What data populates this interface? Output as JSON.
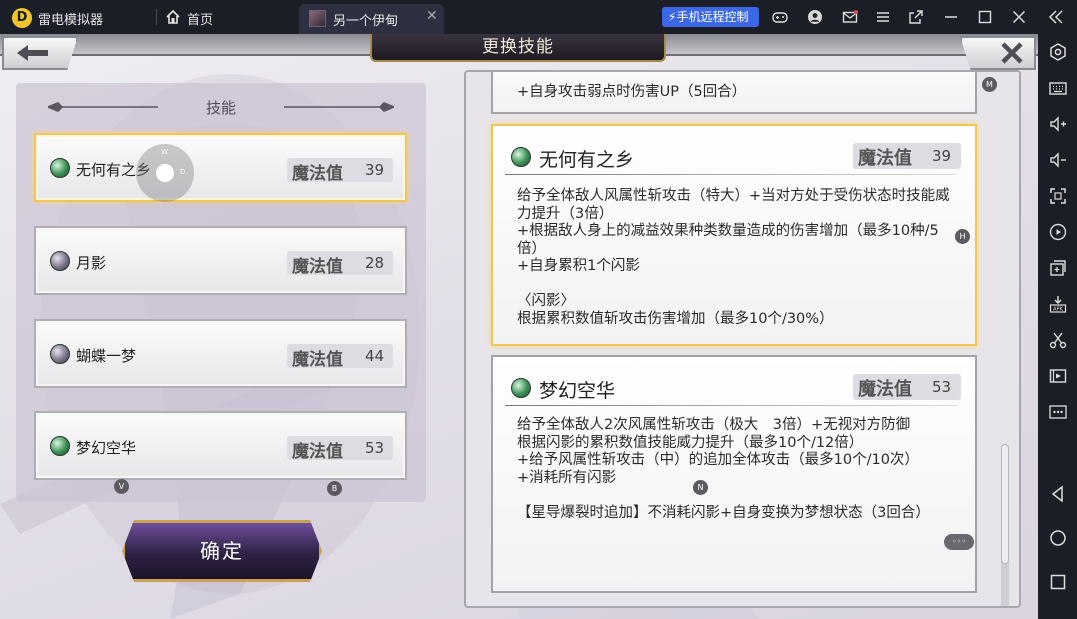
{
  "titlebar": {
    "app_name": "雷电模拟器",
    "home_label": "首页",
    "tab_label": "另一个伊甸",
    "remote_control_label": "手机远程控制"
  },
  "game": {
    "title": "更换技能",
    "list_header": "技能",
    "confirm_label": "确定",
    "mp_label": "魔法值",
    "skills": [
      {
        "name": "无何有之乡",
        "mp": "39",
        "selected": true,
        "gem": "green"
      },
      {
        "name": "月影",
        "mp": "28",
        "selected": false,
        "gem": "purple"
      },
      {
        "name": "蝴蝶一梦",
        "mp": "44",
        "selected": false,
        "gem": "purple"
      },
      {
        "name": "梦幻空华",
        "mp": "53",
        "selected": false,
        "gem": "green"
      }
    ],
    "details": {
      "previous_tail": "+自身攻击弱点时伤害UP（5回合）",
      "cards": [
        {
          "name": "无何有之乡",
          "mp": "39",
          "desc": "给予全体敌人风属性斩攻击（特大）+当对方处于受伤状态时技能威力提升（3倍）\n+根据敌人身上的减益效果种类数量造成的伤害增加（最多10种/5倍）\n+自身累积1个闪影\n\n〈闪影〉\n根据累积数值斩攻击伤害增加（最多10个/30%）"
        },
        {
          "name": "梦幻空华",
          "mp": "53",
          "desc": "给予全体敌人2次风属性斩攻击（极大　3倍）+无视对方防御\n根据闪影的累积数值技能威力提升（最多10个/12倍）\n+给予风属性斩攻击（中）的追加全体攻击（最多10个/10次）\n+消耗所有闪影\n\n【星导爆裂时追加】不消耗闪影+自身变换为梦想状态（3回合）"
        }
      ]
    },
    "key_hints": {
      "m": "M",
      "h": "H",
      "v": "V",
      "b": "B",
      "n": "N",
      "joystick_w": "W",
      "joystick_d": "D"
    }
  },
  "colors": {
    "selected_border": "#f0c55a",
    "remote_btn": "#3c68e8",
    "chrome_bg": "#1c1e27"
  }
}
